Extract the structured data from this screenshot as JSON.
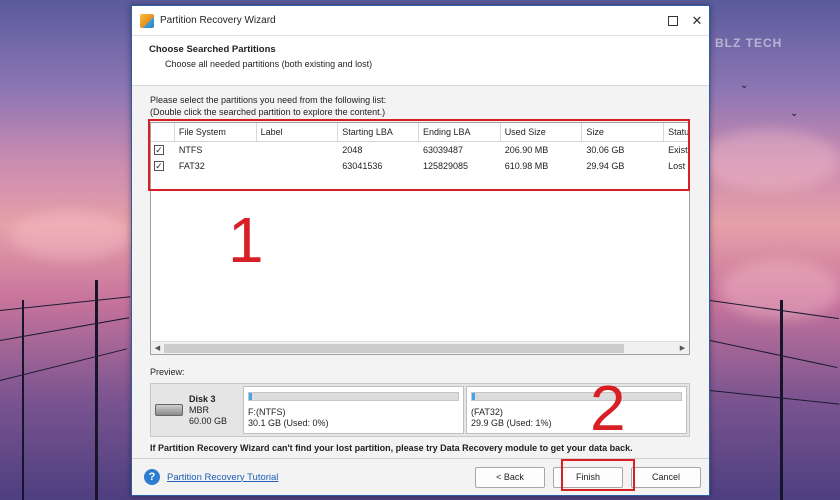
{
  "window": {
    "title": "Partition Recovery Wizard",
    "close_glyph": "✕"
  },
  "header": {
    "title": "Choose Searched Partitions",
    "subtitle": "Choose all needed partitions (both existing and lost)"
  },
  "instructions": {
    "line1": "Please select the partitions you need from the following list:",
    "line2": "(Double click the searched partition to explore the content.)"
  },
  "table": {
    "columns": [
      "File System",
      "Label",
      "Starting LBA",
      "Ending LBA",
      "Used Size",
      "Size",
      "Status"
    ],
    "rows": [
      {
        "checked": true,
        "file_system": "NTFS",
        "label": "",
        "starting_lba": "2048",
        "ending_lba": "63039487",
        "used_size": "206.90 MB",
        "size": "30.06 GB",
        "status": "Existing"
      },
      {
        "checked": true,
        "file_system": "FAT32",
        "label": "",
        "starting_lba": "63041536",
        "ending_lba": "125829085",
        "used_size": "610.98 MB",
        "size": "29.94 GB",
        "status": "Lost"
      }
    ],
    "check_glyph": "✓"
  },
  "preview": {
    "label": "Preview:",
    "disk": {
      "name": "Disk 3",
      "type": "MBR",
      "size": "60.00 GB"
    },
    "partitions": [
      {
        "name": "F:(NTFS)",
        "detail": "30.1 GB (Used: 0%)",
        "used_fraction": 0.01
      },
      {
        "name": "(FAT32)",
        "detail": "29.9 GB (Used: 1%)",
        "used_fraction": 0.01
      }
    ]
  },
  "note": "If Partition Recovery Wizard can't find your lost partition, please try Data Recovery module to get your data back.",
  "footer": {
    "help_glyph": "?",
    "tutorial_link": "Partition Recovery Tutorial",
    "back_label": "< Back",
    "finish_label": "Finish",
    "cancel_label": "Cancel"
  },
  "annotations": {
    "step1": "1",
    "step2": "2"
  },
  "watermark": "BLZ TECH",
  "colors": {
    "accent": "#2e7dd1",
    "highlight": "#d81f26",
    "usage_fill": "#3fa8e6"
  }
}
